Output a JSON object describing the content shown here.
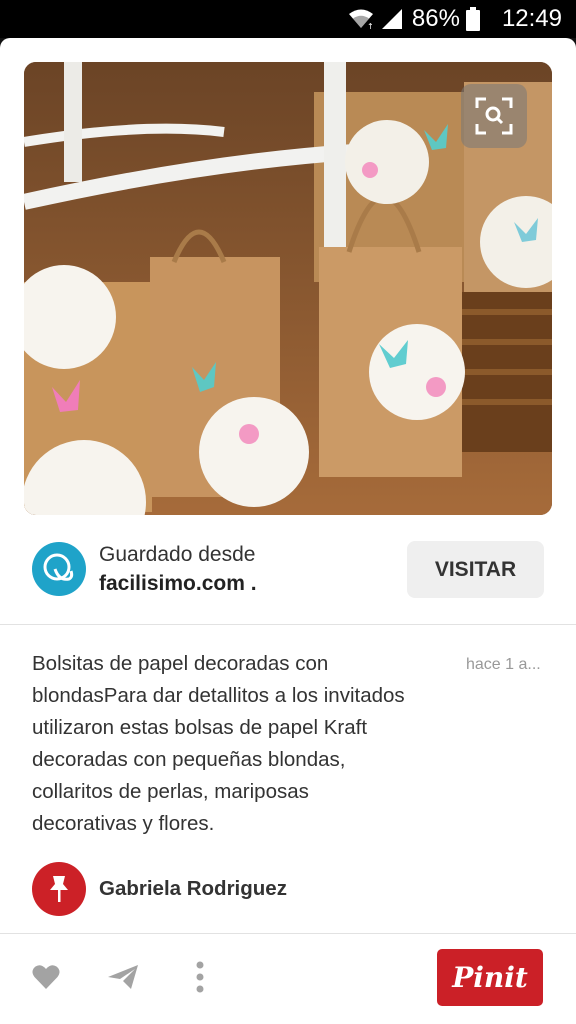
{
  "status_bar": {
    "battery_percent": "86%",
    "time": "12:49",
    "icons": [
      "wifi-icon",
      "signal-icon",
      "battery-icon"
    ]
  },
  "pin": {
    "image": {
      "description": "Kraft paper gift bags with lace doilies and butterflies",
      "expand_icon": "expand-search-icon"
    },
    "source": {
      "label": "Guardado desde",
      "site": "facilisimo.com ."
    },
    "visit_label": "VISITAR",
    "description": "Bolsitas de papel decoradas con blondasPara dar detallitos a los invitados utilizaron estas bolsas de papel Kraft decoradas con pequeñas blondas, collaritos de perlas, mariposas decorativas y flores.",
    "timestamp": "hace 1 a...",
    "pinner": {
      "name": "Gabriela Rodriguez"
    }
  },
  "actions": {
    "like_icon": "heart-icon",
    "send_icon": "send-icon",
    "more_icon": "more-vertical-icon",
    "pinit_label": "Pinit"
  },
  "colors": {
    "pinterest_red": "#cb2027",
    "source_blue": "#1fa3c9"
  }
}
